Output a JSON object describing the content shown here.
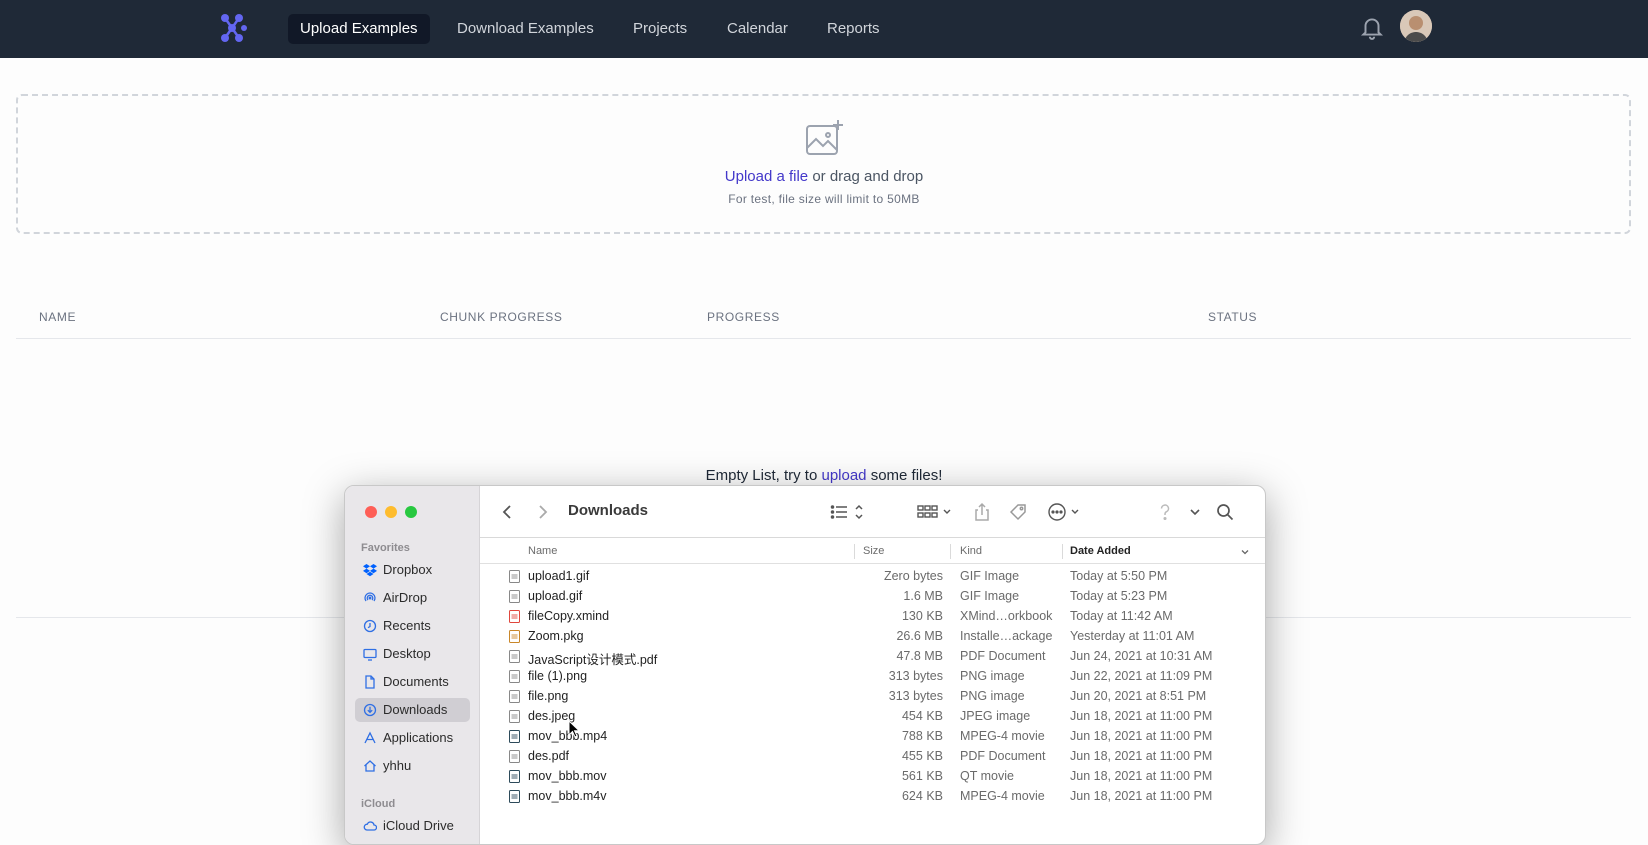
{
  "nav": {
    "items": [
      {
        "label": "Upload Examples",
        "active": true
      },
      {
        "label": "Download Examples",
        "active": false
      },
      {
        "label": "Projects",
        "active": false
      },
      {
        "label": "Calendar",
        "active": false
      },
      {
        "label": "Reports",
        "active": false
      }
    ],
    "logo_icon": "logo-icon",
    "bell_icon": "bell-icon",
    "avatar_icon": "user-avatar"
  },
  "dropzone": {
    "icon": "image-plus-icon",
    "link_text": "Upload a file",
    "rest_text": " or drag and drop",
    "hint": "For test, file size will limit to 50MB"
  },
  "table": {
    "headers": [
      "NAME",
      "CHUNK PROGRESS",
      "PROGRESS",
      "STATUS"
    ],
    "empty_before": "Empty List, try to ",
    "empty_link": "upload",
    "empty_after": " some files!"
  },
  "finder": {
    "title": "Downloads",
    "sidebar": {
      "favorites_label": "Favorites",
      "items": [
        {
          "label": "Dropbox",
          "icon": "dropbox-icon"
        },
        {
          "label": "AirDrop",
          "icon": "airdrop-icon"
        },
        {
          "label": "Recents",
          "icon": "clock-icon"
        },
        {
          "label": "Desktop",
          "icon": "desktop-icon"
        },
        {
          "label": "Documents",
          "icon": "document-icon"
        },
        {
          "label": "Downloads",
          "icon": "download-icon",
          "selected": true
        },
        {
          "label": "Applications",
          "icon": "applications-icon"
        },
        {
          "label": "yhhu",
          "icon": "home-icon"
        }
      ],
      "icloud_label": "iCloud",
      "icloud_items": [
        {
          "label": "iCloud Drive",
          "icon": "cloud-icon"
        }
      ]
    },
    "columns": {
      "name": "Name",
      "size": "Size",
      "kind": "Kind",
      "date": "Date Added"
    },
    "files": [
      {
        "name": "upload1.gif",
        "size": "Zero bytes",
        "kind": "GIF Image",
        "date": "Today at 5:50 PM"
      },
      {
        "name": "upload.gif",
        "size": "1.6 MB",
        "kind": "GIF Image",
        "date": "Today at 5:23 PM"
      },
      {
        "name": "fileCopy.xmind",
        "size": "130 KB",
        "kind": "XMind…orkbook",
        "date": "Today at 11:42 AM"
      },
      {
        "name": "Zoom.pkg",
        "size": "26.6 MB",
        "kind": "Installe…ackage",
        "date": "Yesterday at 11:01 AM"
      },
      {
        "name": "JavaScript设计模式.pdf",
        "size": "47.8 MB",
        "kind": "PDF Document",
        "date": "Jun 24, 2021 at 10:31 AM"
      },
      {
        "name": "file (1).png",
        "size": "313 bytes",
        "kind": "PNG image",
        "date": "Jun 22, 2021 at 11:09 PM"
      },
      {
        "name": "file.png",
        "size": "313 bytes",
        "kind": "PNG image",
        "date": "Jun 20, 2021 at 8:51 PM"
      },
      {
        "name": "des.jpeg",
        "size": "454 KB",
        "kind": "JPEG image",
        "date": "Jun 18, 2021 at 11:00 PM"
      },
      {
        "name": "mov_bbb.mp4",
        "size": "788 KB",
        "kind": "MPEG-4 movie",
        "date": "Jun 18, 2021 at 11:00 PM"
      },
      {
        "name": "des.pdf",
        "size": "455 KB",
        "kind": "PDF Document",
        "date": "Jun 18, 2021 at 11:00 PM"
      },
      {
        "name": "mov_bbb.mov",
        "size": "561 KB",
        "kind": "QT movie",
        "date": "Jun 18, 2021 at 11:00 PM"
      },
      {
        "name": "mov_bbb.m4v",
        "size": "624 KB",
        "kind": "MPEG-4 movie",
        "date": "Jun 18, 2021 at 11:00 PM"
      }
    ]
  },
  "colors": {
    "nav_bg": "#1f2937",
    "accent": "#4338ca"
  }
}
